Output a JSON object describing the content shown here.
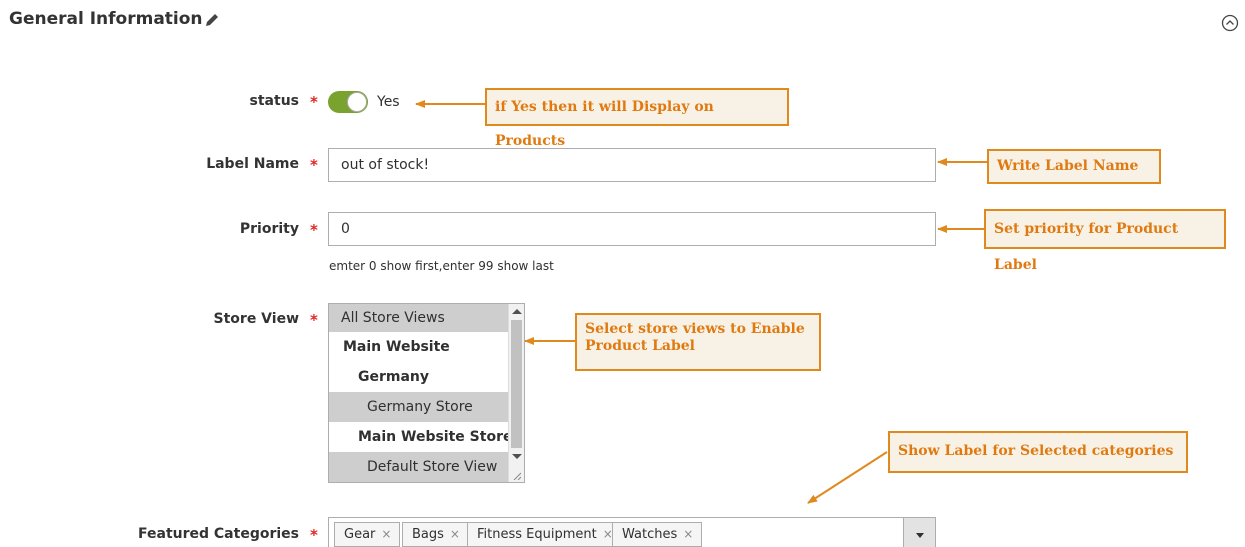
{
  "section": {
    "title": "General Information"
  },
  "icons": {
    "edit": "pencil-icon",
    "collapse": "chevron-up-circle-icon"
  },
  "fields": {
    "status": {
      "label": "status",
      "required": "*",
      "value_text": "Yes",
      "enabled": true
    },
    "label_name": {
      "label": "Label Name",
      "required": "*",
      "value": "out of stock!"
    },
    "priority": {
      "label": "Priority",
      "required": "*",
      "value": "0",
      "note": "emter 0 show first,enter 99 show last"
    },
    "store_view": {
      "label": "Store View",
      "required": "*",
      "options": [
        {
          "label": "All Store Views",
          "selected": true
        },
        {
          "label": "Main Website",
          "selected": false
        },
        {
          "label": "Germany",
          "selected": false
        },
        {
          "label": "Germany Store",
          "selected": true
        },
        {
          "label": "Main Website Store",
          "selected": false
        },
        {
          "label": "Default Store View",
          "selected": true
        }
      ]
    },
    "featured_categories": {
      "label": "Featured Categories",
      "required": "*",
      "tags": [
        "Gear",
        "Bags",
        "Fitness Equipment",
        "Watches"
      ],
      "remove_glyph": "×"
    }
  },
  "callouts": {
    "status": "if Yes then it will Display on Products",
    "label_name": "Write Label Name",
    "priority": "Set priority for Product Label",
    "store_view_line1": "Select store views to Enable",
    "store_view_line2": "Product Label",
    "categories": "Show Label for Selected categories"
  },
  "colors": {
    "toggle_on": "#79a22e",
    "required": "#e22626",
    "callout_border": "#e08a1e",
    "callout_text": "#e07a10",
    "callout_bg": "#f8f2e6"
  }
}
